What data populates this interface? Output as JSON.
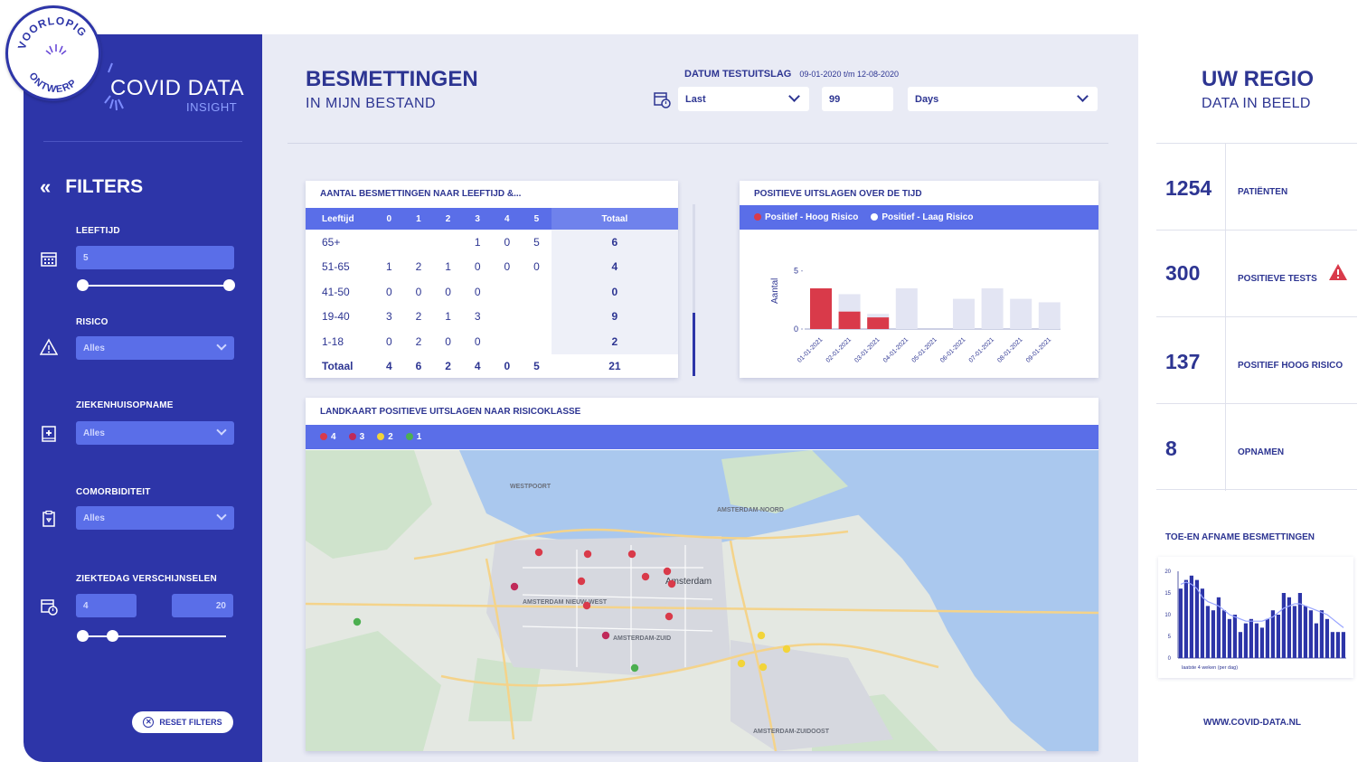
{
  "badge": {
    "top_text": "VOORLOPIG",
    "bottom_text": "ONTWERP"
  },
  "brand": {
    "name": "COVID DATA",
    "sub": "INSIGHT"
  },
  "filters": {
    "title": "FILTERS",
    "collapse_icon": "double-chevron-left-icon",
    "leeftijd": {
      "label": "LEEFTIJD",
      "value": "5",
      "icon": "calendar-icon"
    },
    "risico": {
      "label": "RISICO",
      "value": "Alles",
      "icon": "warning-icon"
    },
    "ziekenhuisopname": {
      "label": "ZIEKENHUISOPNAME",
      "value": "Alles",
      "icon": "hospital-icon"
    },
    "comorbiditeit": {
      "label": "COMORBIDITEIT",
      "value": "Alles",
      "icon": "clipboard-icon"
    },
    "ziektedag": {
      "label": "ZIEKTEDAG VERSCHIJNSELEN",
      "min": "4",
      "max": "20",
      "icon": "calendar-clock-icon"
    },
    "reset": "RESET FILTERS"
  },
  "header": {
    "title": "BESMETTINGEN",
    "subtitle": "IN MIJN BESTAND",
    "date_label": "DATUM TESTUITSLAG",
    "date_range": "09-01-2020 t/m 12-08-2020",
    "period_mode": "Last",
    "period_value": "99",
    "period_unit": "Days"
  },
  "age_table": {
    "title": "AANTAL BESMETTINGEN NAAR LEEFTIJD &...",
    "headers": [
      "Leeftijd",
      "0",
      "1",
      "2",
      "3",
      "4",
      "5",
      "Totaal"
    ],
    "rows": [
      [
        "65+",
        "",
        "",
        "",
        "1",
        "0",
        "5",
        "6"
      ],
      [
        "51-65",
        "1",
        "2",
        "1",
        "0",
        "0",
        "0",
        "4"
      ],
      [
        "41-50",
        "0",
        "0",
        "0",
        "0",
        "",
        "",
        "0"
      ],
      [
        "19-40",
        "3",
        "2",
        "1",
        "3",
        "",
        "",
        "9"
      ],
      [
        "1-18",
        "0",
        "2",
        "0",
        "0",
        "",
        "",
        "2"
      ]
    ],
    "total": [
      "Totaal",
      "4",
      "6",
      "2",
      "4",
      "0",
      "5",
      "21"
    ]
  },
  "pos_chart": {
    "title": "POSITIEVE UITSLAGEN OVER DE TIJD",
    "ylabel": "Aantal",
    "yticks": [
      "0",
      "5"
    ]
  },
  "chart_data": [
    {
      "type": "bar",
      "title": "POSITIEVE UITSLAGEN OVER DE TIJD",
      "ylabel": "Aantal",
      "categories": [
        "01-01-2021",
        "02-01-2021",
        "03-01-2021",
        "04-01-2021",
        "05-01-2021",
        "06-01-2021",
        "07-01-2021",
        "08-01-2021",
        "09-01-2021"
      ],
      "series": [
        {
          "name": "Positief - Hoog Risico",
          "values": [
            3.5,
            1.5,
            1,
            0,
            0,
            0,
            0,
            0,
            0
          ],
          "color": "#d93a4a"
        },
        {
          "name": "Positief - Laag Risico",
          "values": [
            3.5,
            3,
            1.3,
            3.5,
            0,
            2.6,
            3.5,
            2.6,
            2.3
          ],
          "color": "#e3e5f3"
        }
      ],
      "stacked": true,
      "ylim": [
        0,
        7
      ]
    },
    {
      "type": "bar",
      "title": "TOE-EN AFNAME BESMETTINGEN",
      "xlabel": "laatste 4 weken (per dag)",
      "yticks": [
        "0",
        "5",
        "10",
        "15",
        "20"
      ],
      "ylim": [
        0,
        20
      ],
      "values": [
        16,
        18,
        19,
        18,
        16,
        12,
        11,
        14,
        11,
        9,
        10,
        6,
        8,
        9,
        8,
        7,
        9,
        11,
        10,
        15,
        14,
        12,
        15,
        12,
        11,
        8,
        11,
        9,
        6,
        6,
        6
      ],
      "line": [
        17,
        17.5,
        17,
        16,
        14,
        13,
        12.5,
        12,
        11,
        10,
        9.5,
        9,
        8.5,
        8.5,
        8.5,
        8.5,
        9,
        9.5,
        10.5,
        11.5,
        12,
        12.5,
        12.5,
        12,
        11.5,
        11,
        10.5,
        10,
        9,
        8,
        7
      ]
    }
  ],
  "map": {
    "title": "LANDKAART POSITIEVE UITSLAGEN NAAR RISICOKLASSE",
    "legend": [
      {
        "label": "4",
        "color": "#d93a4a"
      },
      {
        "label": "3",
        "color": "#c02a5a"
      },
      {
        "label": "2",
        "color": "#f2d43a"
      },
      {
        "label": "1",
        "color": "#4caf50"
      }
    ],
    "place_labels": [
      "WESTPOORT",
      "AMSTERDAM-NOORD",
      "Amsterdam",
      "AMSTERDAM NIEUW-WEST",
      "AMSTERDAM-ZUID",
      "AMSTERDAM-ZUIDOOST"
    ]
  },
  "region": {
    "title": "UW REGIO",
    "subtitle": "DATA IN BEELD",
    "stats": [
      {
        "value": "1254",
        "label": "PATIËNTEN"
      },
      {
        "value": "300",
        "label": "POSITIEVE TESTS",
        "alert": true
      },
      {
        "value": "137",
        "label": "POSITIEF HOOG RISICO"
      },
      {
        "value": "8",
        "label": "OPNAMEN"
      }
    ],
    "trend_title": "TOE-EN AFNAME BESMETTINGEN",
    "trend_xlabel": "laatste 4 weken (per dag)",
    "site": "WWW.COVID-DATA.NL"
  }
}
